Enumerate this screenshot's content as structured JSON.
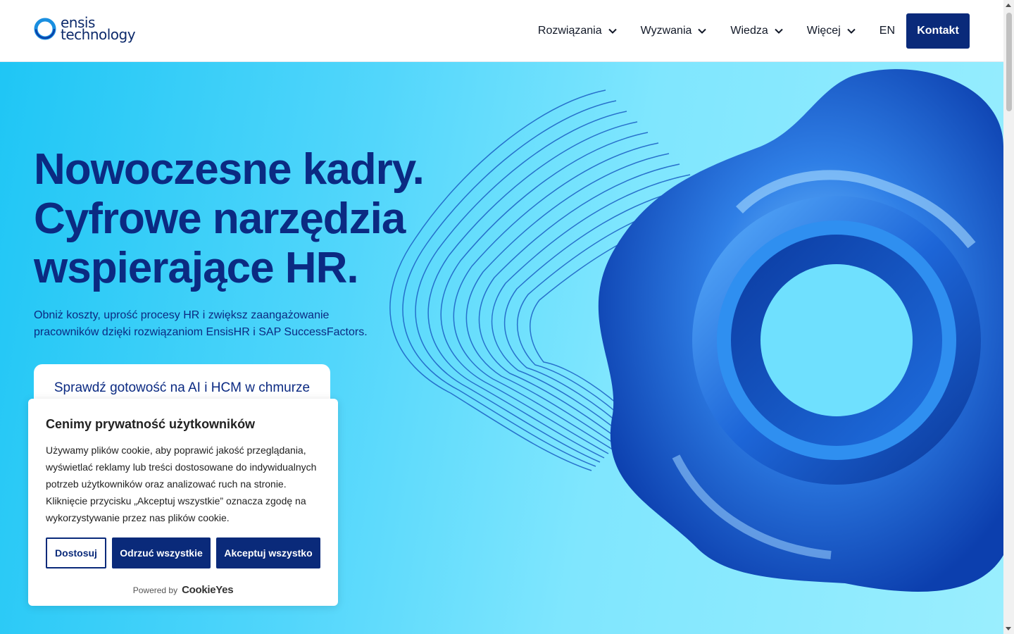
{
  "header": {
    "logo_line1": "ensis",
    "logo_line2": "technology",
    "nav": [
      {
        "label": "Rozwiązania"
      },
      {
        "label": "Wyzwania"
      },
      {
        "label": "Wiedza"
      },
      {
        "label": "Więcej"
      }
    ],
    "lang": "EN",
    "contact_label": "Kontakt"
  },
  "hero": {
    "title_lines": [
      "Nowoczesne kadry.",
      "Cyfrowe narzędzia",
      "wspierające HR."
    ],
    "subtitle": "Obniż koszty, uprość procesy HR i zwiększ zaangażowanie pracowników dzięki rozwiązaniom EnsisHR i SAP SuccessFactors.",
    "cta_label": "Sprawdź gotowość na AI i HCM w chmurze"
  },
  "cookie": {
    "title": "Cenimy prywatność użytkowników",
    "text": "Używamy plików cookie, aby poprawić jakość przeglądania, wyświetlać reklamy lub treści dostosowane do indywidualnych potrzeb użytkowników oraz analizować ruch na stronie. Kliknięcie przycisku „Akceptuj wszystkie” oznacza zgodę na wykorzystywanie przez nas plików cookie.",
    "customize_label": "Dostosuj",
    "reject_label": "Odrzuć wszystkie",
    "accept_label": "Akceptuj wszystko",
    "powered_by": "Powered by",
    "powered_brand": "CookieYes"
  },
  "colors": {
    "brand_navy": "#0a2a7a",
    "hero_cyan": "#1fc6f5",
    "title_blue": "#0b2a82"
  },
  "icons": {
    "logo": "ensis-ring-logo-icon",
    "nav_chevron": "chevron-down-icon"
  }
}
